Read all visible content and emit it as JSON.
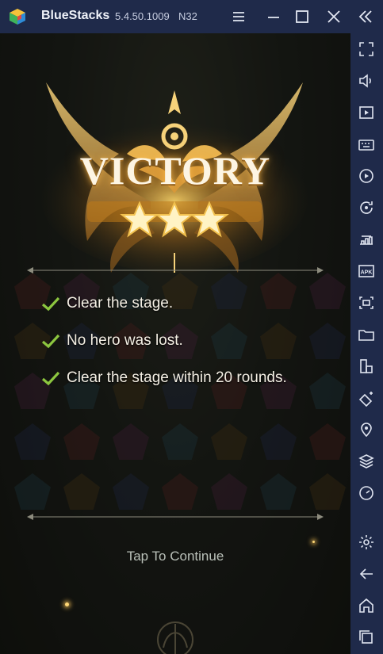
{
  "window": {
    "app_name": "BlueStacks",
    "version": "5.4.50.1009",
    "build": "N32",
    "icons": [
      "hamburger-menu-icon",
      "minimize-icon",
      "maximize-icon",
      "close-icon",
      "collapse-sidebar-icon"
    ]
  },
  "sidebar": {
    "items": [
      {
        "name": "fullscreen-icon"
      },
      {
        "name": "volume-icon"
      },
      {
        "name": "screen-record-icon"
      },
      {
        "name": "keyboard-controls-icon"
      },
      {
        "name": "macro-recorder-icon"
      },
      {
        "name": "sync-icon"
      },
      {
        "name": "performance-icon"
      },
      {
        "name": "install-apk-icon"
      },
      {
        "name": "screenshot-icon"
      },
      {
        "name": "folder-icon"
      },
      {
        "name": "multi-instance-icon"
      },
      {
        "name": "eco-mode-icon"
      },
      {
        "name": "location-icon"
      },
      {
        "name": "layers-icon"
      },
      {
        "name": "speed-gauge-icon"
      },
      {
        "name": "settings-icon"
      },
      {
        "name": "back-icon"
      },
      {
        "name": "home-icon"
      },
      {
        "name": "recent-apps-icon"
      }
    ]
  },
  "game": {
    "title": "VICTORY",
    "stars_earned": 3,
    "stars_total": 3,
    "objectives": [
      {
        "text": "Clear the stage.",
        "completed": true
      },
      {
        "text": "No hero was lost.",
        "completed": true
      },
      {
        "text": "Clear the stage within 20 rounds.",
        "completed": true
      }
    ],
    "continue_prompt": "Tap To Continue"
  },
  "colors": {
    "titlebar": "#1f2a4a",
    "accent_gold": "#f2c14e",
    "check_green": "#8cc63f"
  }
}
